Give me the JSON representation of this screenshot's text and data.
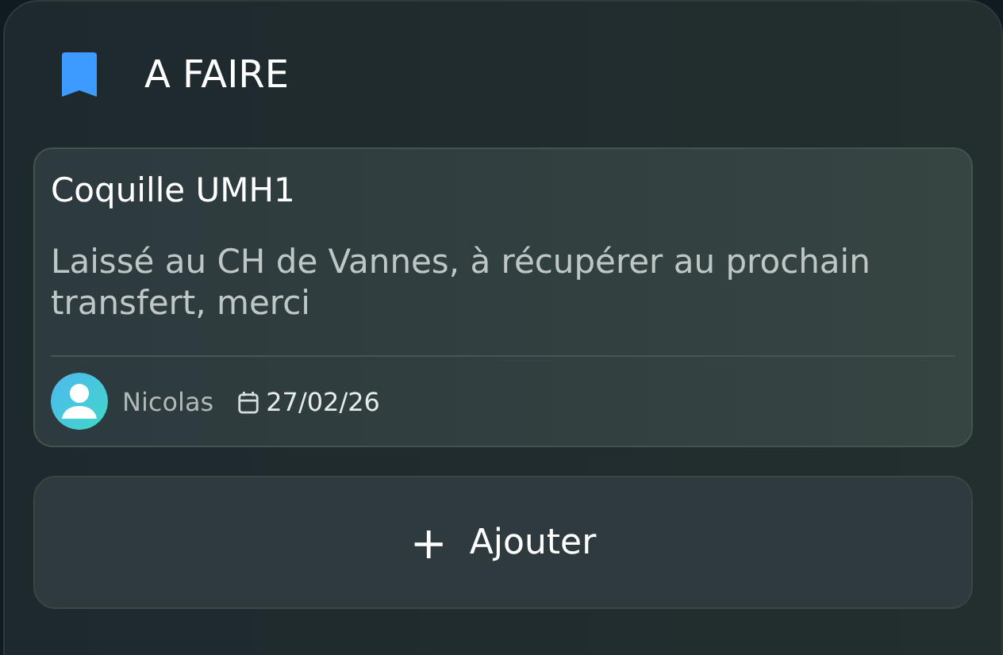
{
  "column": {
    "title": "A FAIRE"
  },
  "cards": [
    {
      "title": "Coquille UMH1",
      "description": "Laissé au CH de Vannes, à récupérer au prochain transfert, merci",
      "author": "Nicolas",
      "date": "27/02/26"
    }
  ],
  "add_button": {
    "label": "Ajouter",
    "icon": "+"
  }
}
